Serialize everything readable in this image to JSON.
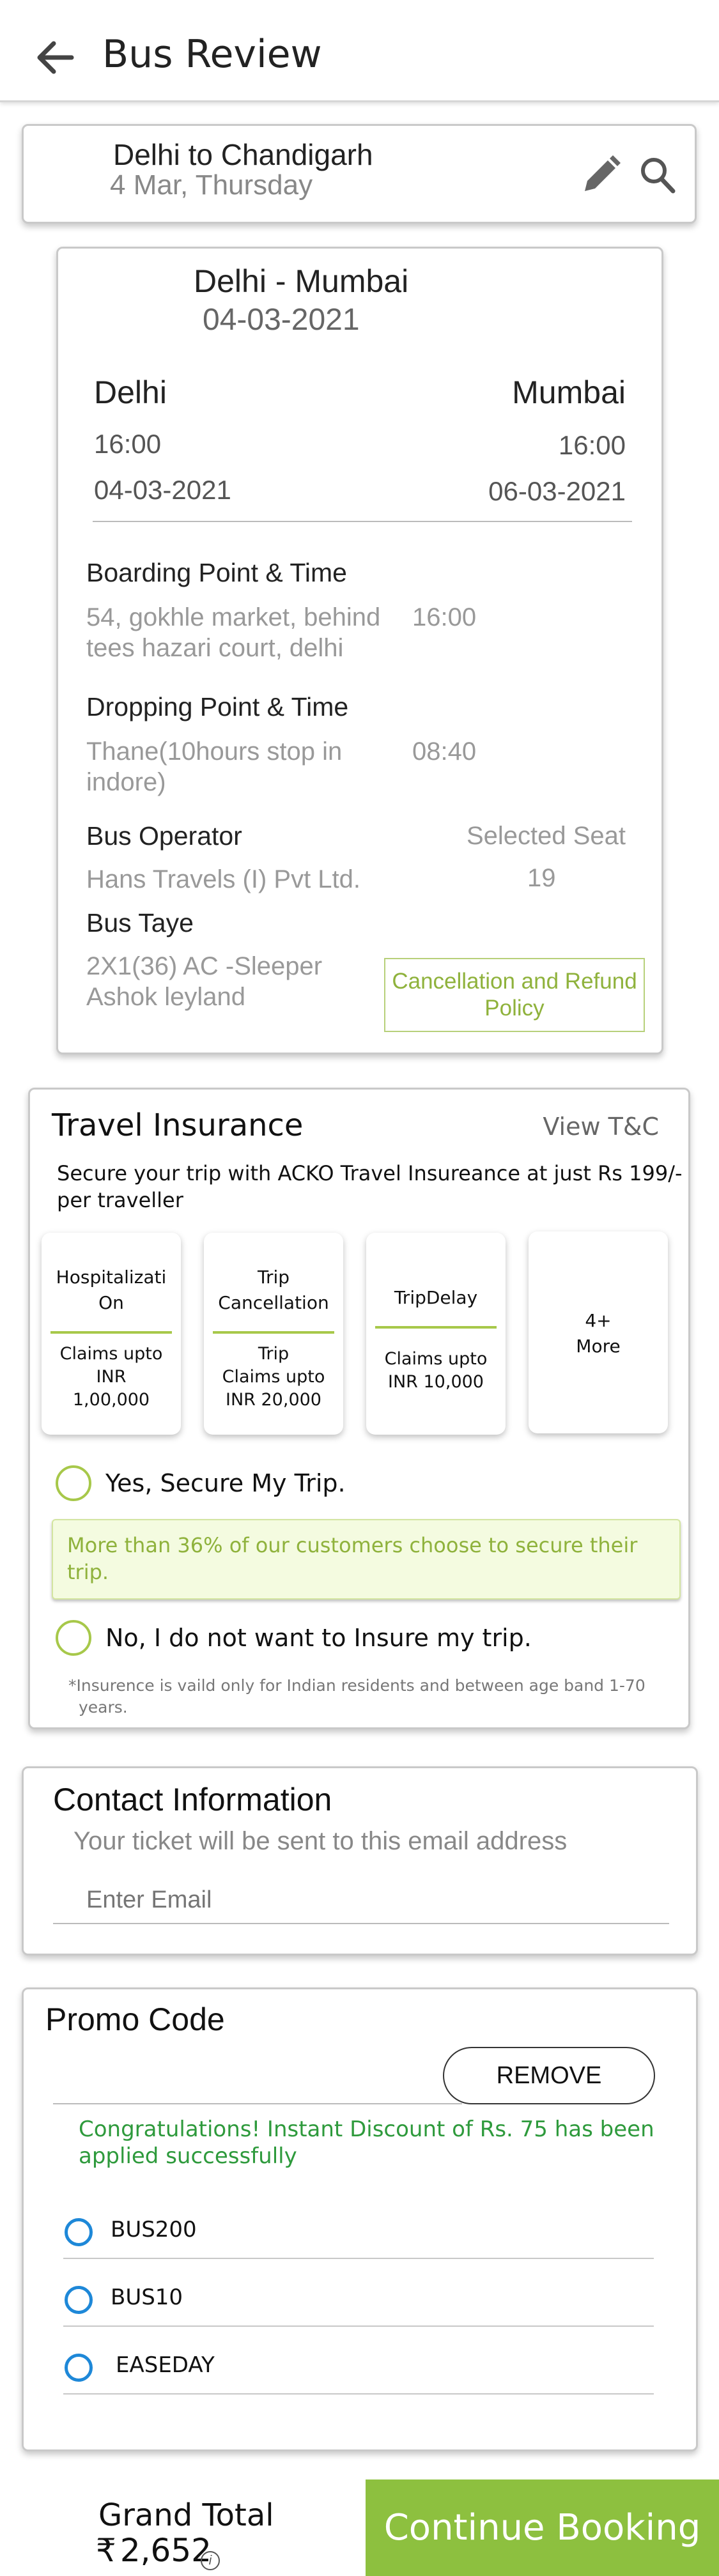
{
  "header": {
    "title": "Bus Review",
    "back_icon": "arrow-left-icon"
  },
  "search": {
    "route": "Delhi to Chandigarh",
    "date": "4 Mar, Thursday",
    "edit_icon": "pencil-icon",
    "search_icon": "search-icon"
  },
  "journey": {
    "route": "Delhi  -  Mumbai",
    "date": "04-03-2021",
    "from": {
      "city": "Delhi",
      "time": "16:00",
      "date": "04-03-2021"
    },
    "to": {
      "city": "Mumbai",
      "time": "16:00",
      "date": "06-03-2021"
    },
    "boarding": {
      "label": "Boarding Point & Time",
      "place_line1": "54, gokhle market, behind",
      "place_line2": "tees hazari court, delhi",
      "time": "16:00"
    },
    "dropping": {
      "label": "Dropping Point & Time",
      "place_line1": "Thane(10hours stop in",
      "place_line2": "indore)",
      "time": "08:40"
    },
    "operator": {
      "label": "Bus Operator",
      "value": "Hans Travels (I) Pvt Ltd."
    },
    "seat": {
      "label": "Selected Seat",
      "value": "19"
    },
    "bus_type": {
      "label": "Bus Taye",
      "line1": "2X1(36) AC -Sleeper",
      "line2": "Ashok leyland"
    },
    "policy_line1": "Cancellation and Refund",
    "policy_line2": "Policy"
  },
  "insurance": {
    "title": "Travel Insurance",
    "tnc": "View T&C",
    "desc_line1": "Secure your trip with ACKO Travel Insureance at just Rs 199/-",
    "desc_line2": "per traveller",
    "tiles": [
      {
        "title1": "Hospitalizati",
        "title2": "On",
        "claim1": "Claims upto",
        "claim2": "INR",
        "claim3": "1,00,000"
      },
      {
        "title1": "Trip",
        "title2": "Cancellation",
        "claim1": "Trip",
        "claim2": "Claims upto",
        "claim3": "INR 20,000"
      },
      {
        "title1": "TripDelay",
        "claim1": "Claims upto",
        "claim2": "INR 10,000"
      },
      {
        "title1": "4+",
        "title2": "More"
      }
    ],
    "yes_label": "Yes, Secure My Trip.",
    "note_line1": "More than 36% of our customers choose to secure their",
    "note_line2": "trip.",
    "no_label": "No, I do not want to Insure my trip.",
    "footnote_line1": "*Insurence is vaild only for Indian residents and between age band 1-70",
    "footnote_line2": "years."
  },
  "contact": {
    "title": "Contact Information",
    "subtitle": "Your ticket will be sent to this email address",
    "email_placeholder": "Enter Email"
  },
  "promo": {
    "title": "Promo Code",
    "remove_label": "REMOVE",
    "success_line1": "Congratulations! Instant Discount of Rs. 75 has been",
    "success_line2": "applied successfully",
    "codes": [
      "BUS200",
      "BUS10",
      "EASEDAY"
    ]
  },
  "footer": {
    "total_label": "Grand Total",
    "currency": "₹",
    "amount": "2,652",
    "info_icon": "info-icon",
    "cta": "Continue Booking"
  },
  "colors": {
    "accent_green": "#8dc03f",
    "radio_blue": "#1e88d8",
    "success_green": "#2e9a3c"
  }
}
